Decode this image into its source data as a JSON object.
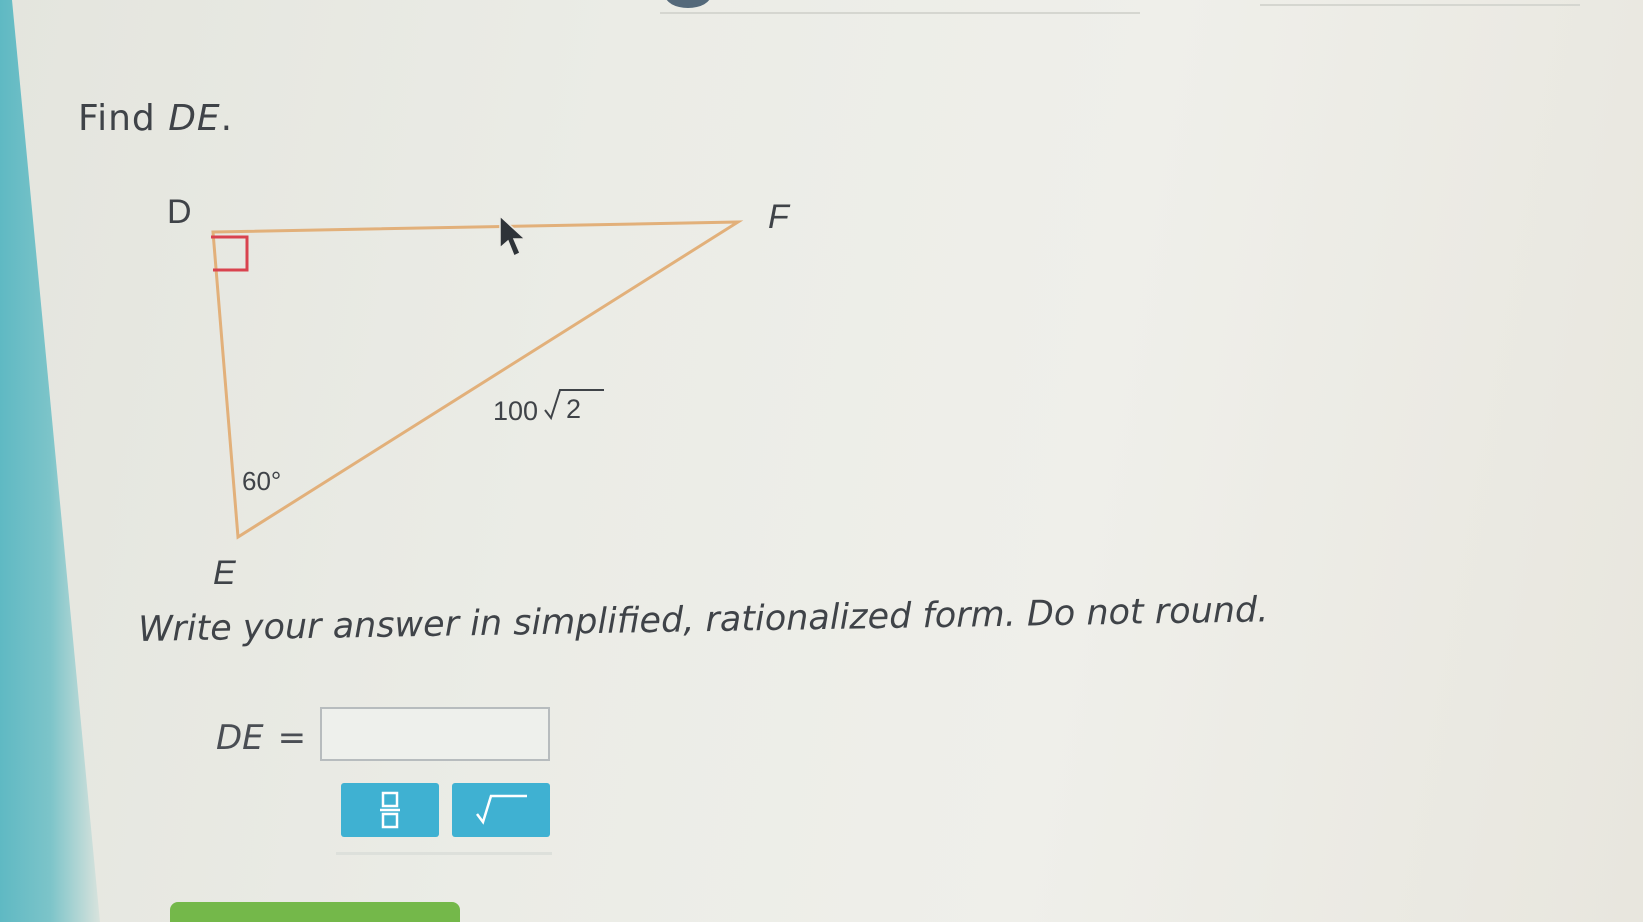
{
  "question": {
    "prefix": "Find ",
    "target": "DE",
    "suffix": "."
  },
  "figure": {
    "vertex_d": "D",
    "vertex_e": "E",
    "vertex_f": "F",
    "hypotenuse_coefficient": "100",
    "hypotenuse_radicand": "2",
    "angle_e": "60°"
  },
  "instruction": "Write your answer in simplified, rationalized form. Do not round.",
  "answer": {
    "label": "DE",
    "equals": "=",
    "value": "",
    "placeholder": ""
  },
  "icons": {
    "fraction_button": "fraction-icon",
    "sqrt_button": "square-root-icon"
  },
  "colors": {
    "triangle_stroke": "#e2b07a",
    "right_angle_marker": "#d9434f",
    "tool_button": "#3fb1d2",
    "submit_button": "#74b84a"
  }
}
